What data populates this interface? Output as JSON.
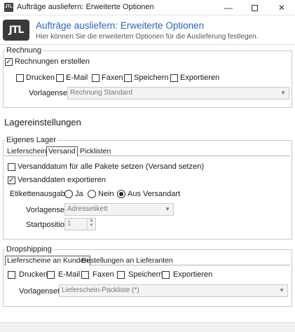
{
  "window": {
    "title": "Aufträge ausliefern: Erweiterte Optionen"
  },
  "header": {
    "logo_text": "JTL",
    "title": "Aufträge ausliefern: Erweiterte Optionen",
    "subtitle": "Hier können Sie die erweiterten Optionen für die Auslieferung festlegen."
  },
  "rechnung": {
    "group_label": "Rechnung",
    "create_label": "Rechnungen erstellen",
    "create_checked": true,
    "options": [
      "Drucken",
      "E-Mail",
      "Faxen",
      "Speichern",
      "Exportieren"
    ],
    "vorlagenset_label": "Vorlagenset:",
    "vorlagenset_value": "Rechnung Standard"
  },
  "lager": {
    "section_title": "Lagereinstellungen",
    "group_label": "Eigenes Lager",
    "tabs": [
      "Lieferscheine",
      "Versand",
      "Picklisten"
    ],
    "active_tab": "Versand",
    "versanddatum_label": "Versanddatum für alle Pakete setzen (Versand setzen)",
    "versanddatum_checked": false,
    "export_label": "Versanddaten exportieren",
    "export_checked": true,
    "etiketten_label": "Etikettenausgabe:",
    "etiketten_options": [
      "Ja",
      "Nein",
      "Aus Versandart"
    ],
    "etiketten_selected": "Aus Versandart",
    "vorlagenset_label": "Vorlagenset:",
    "vorlagenset_value": "Adressetikett",
    "startposition_label": "Startposition",
    "startposition_value": "1"
  },
  "dropshipping": {
    "group_label": "Dropshipping",
    "tabs": [
      "Lieferscheine an Kunden",
      "Bestellungen an Lieferanten"
    ],
    "active_tab": "Lieferscheine an Kunden",
    "options": [
      "Drucken",
      "E-Mail",
      "Faxen",
      "Speichern",
      "Exportieren"
    ],
    "vorlagenset_label": "Vorlagenset:",
    "vorlagenset_value": "Lieferschein-Packliste (*)"
  }
}
